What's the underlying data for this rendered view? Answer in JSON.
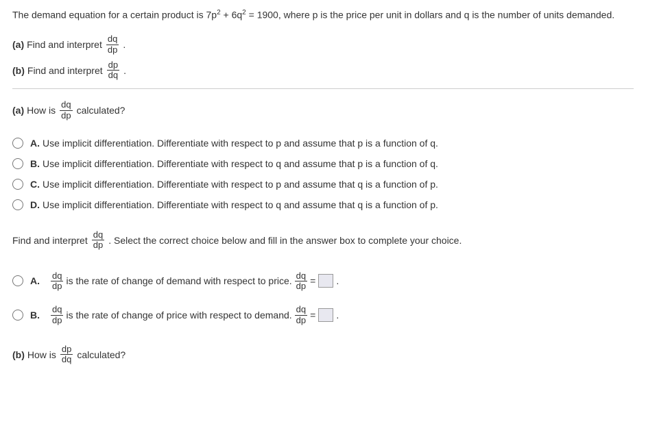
{
  "intro": "The demand equation for a certain product is 7p² + 6q² = 1900, where p is the price per unit in dollars and q is the number of units demanded.",
  "parts": {
    "a": {
      "label": "(a)",
      "text_before": "Find and interpret",
      "frac_num": "dq",
      "frac_den": "dp",
      "text_after": "."
    },
    "b": {
      "label": "(b)",
      "text_before": "Find and interpret",
      "frac_num": "dp",
      "frac_den": "dq",
      "text_after": "."
    }
  },
  "question_a": {
    "label": "(a)",
    "text_before": "How is",
    "frac_num": "dq",
    "frac_den": "dp",
    "text_after": "calculated?"
  },
  "choices_a": [
    {
      "letter": "A.",
      "text": "Use implicit differentiation. Differentiate with respect to p and assume that p is a function of q."
    },
    {
      "letter": "B.",
      "text": "Use implicit differentiation. Differentiate with respect to q and assume that p is a function of q."
    },
    {
      "letter": "C.",
      "text": "Use implicit differentiation. Differentiate with respect to p and assume that q is a function of p."
    },
    {
      "letter": "D.",
      "text": "Use implicit differentiation. Differentiate with respect to q and assume that q is a function of p."
    }
  ],
  "interpret": {
    "text_before": "Find and interpret",
    "frac_num": "dq",
    "frac_den": "dp",
    "text_after": ". Select the correct choice below and fill in the answer box to complete your choice."
  },
  "interpret_choices": [
    {
      "letter": "A.",
      "frac1_num": "dq",
      "frac1_den": "dp",
      "mid_text": "is the rate of change of demand with respect to price.",
      "frac2_num": "dq",
      "frac2_den": "dp",
      "eq": "="
    },
    {
      "letter": "B.",
      "frac1_num": "dq",
      "frac1_den": "dp",
      "mid_text": "is the rate of change of price with respect to demand.",
      "frac2_num": "dq",
      "frac2_den": "dp",
      "eq": "="
    }
  ],
  "question_b": {
    "label": "(b)",
    "text_before": "How is",
    "frac_num": "dp",
    "frac_den": "dq",
    "text_after": "calculated?"
  }
}
